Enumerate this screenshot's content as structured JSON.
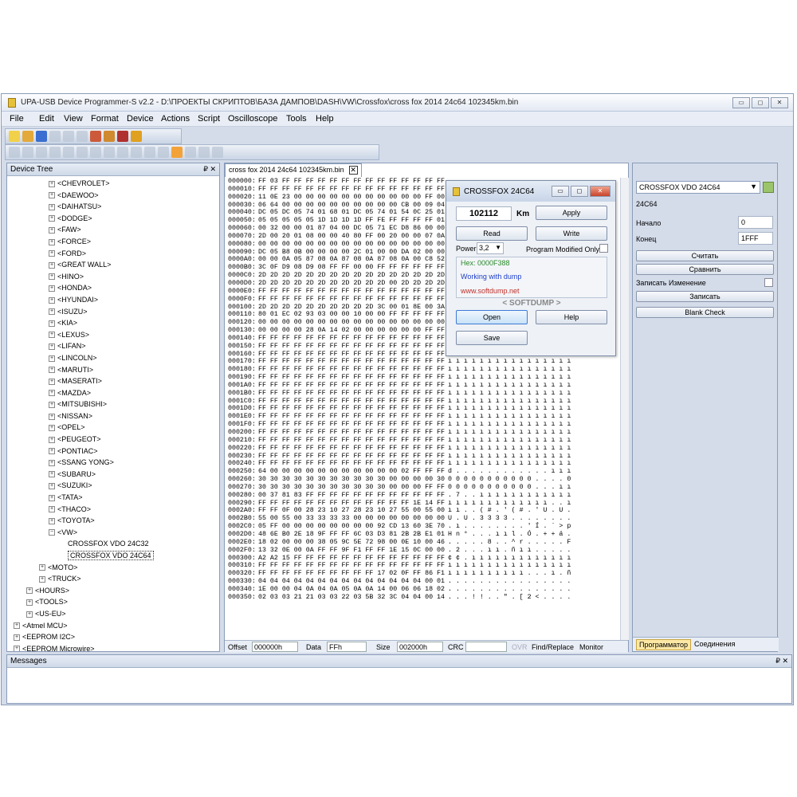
{
  "window": {
    "title": "UPA-USB Device Programmer-S v2.2 - D:\\ПРОЕКТЫ СКРИПТОВ\\БАЗА ДАМПОВ\\DASH\\VW\\Crossfox\\cross fox 2014 24c64 102345km.bin",
    "buttons": {
      "minimize": "▭",
      "maximize": "◻",
      "close": "✕"
    }
  },
  "menu": [
    "File",
    "Edit",
    "View",
    "Format",
    "Device",
    "Actions",
    "Script",
    "Oscilloscope",
    "Tools",
    "Help"
  ],
  "device_tree": {
    "title": "Device Tree",
    "pin": "₽ ✕",
    "items": [
      {
        "label": "<CHEVROLET>",
        "level": 2,
        "exp": "+"
      },
      {
        "label": "<DAEWOO>",
        "level": 2,
        "exp": "+"
      },
      {
        "label": "<DAIHATSU>",
        "level": 2,
        "exp": "+"
      },
      {
        "label": "<DODGE>",
        "level": 2,
        "exp": "+"
      },
      {
        "label": "<FAW>",
        "level": 2,
        "exp": "+"
      },
      {
        "label": "<FORCE>",
        "level": 2,
        "exp": "+"
      },
      {
        "label": "<FORD>",
        "level": 2,
        "exp": "+"
      },
      {
        "label": "<GREAT WALL>",
        "level": 2,
        "exp": "+"
      },
      {
        "label": "<HINO>",
        "level": 2,
        "exp": "+"
      },
      {
        "label": "<HONDA>",
        "level": 2,
        "exp": "+"
      },
      {
        "label": "<HYUNDAI>",
        "level": 2,
        "exp": "+"
      },
      {
        "label": "<ISUZU>",
        "level": 2,
        "exp": "+"
      },
      {
        "label": "<KIA>",
        "level": 2,
        "exp": "+"
      },
      {
        "label": "<LEXUS>",
        "level": 2,
        "exp": "+"
      },
      {
        "label": "<LIFAN>",
        "level": 2,
        "exp": "+"
      },
      {
        "label": "<LINCOLN>",
        "level": 2,
        "exp": "+"
      },
      {
        "label": "<MARUTI>",
        "level": 2,
        "exp": "+"
      },
      {
        "label": "<MASERATI>",
        "level": 2,
        "exp": "+"
      },
      {
        "label": "<MAZDA>",
        "level": 2,
        "exp": "+"
      },
      {
        "label": "<MITSUBISHI>",
        "level": 2,
        "exp": "+"
      },
      {
        "label": "<NISSAN>",
        "level": 2,
        "exp": "+"
      },
      {
        "label": "<OPEL>",
        "level": 2,
        "exp": "+"
      },
      {
        "label": "<PEUGEOT>",
        "level": 2,
        "exp": "+"
      },
      {
        "label": "<PONTIAC>",
        "level": 2,
        "exp": "+"
      },
      {
        "label": "<SSANG YONG>",
        "level": 2,
        "exp": "+"
      },
      {
        "label": "<SUBARU>",
        "level": 2,
        "exp": "+"
      },
      {
        "label": "<SUZUKI>",
        "level": 2,
        "exp": "+"
      },
      {
        "label": "<TATA>",
        "level": 2,
        "exp": "+"
      },
      {
        "label": "<THACO>",
        "level": 2,
        "exp": "+"
      },
      {
        "label": "<TOYOTA>",
        "level": 2,
        "exp": "+"
      },
      {
        "label": "<VW>",
        "level": 2,
        "exp": "−"
      },
      {
        "label": "CROSSFOX VDO 24C32",
        "level": 3,
        "exp": ""
      },
      {
        "label": "CROSSFOX VDO 24C64",
        "level": 3,
        "exp": "",
        "selected": true
      },
      {
        "label": "<MOTO>",
        "level": 1,
        "exp": "+"
      },
      {
        "label": "<TRUCK>",
        "level": 1,
        "exp": "+"
      },
      {
        "label": "<HOURS>",
        "level": 0,
        "exp": "+"
      },
      {
        "label": "<TOOLS>",
        "level": 0,
        "exp": "+"
      },
      {
        "label": "<US-EU>",
        "level": 0,
        "exp": "+"
      },
      {
        "label": "<Atmel MCU>",
        "level": -1,
        "exp": "+"
      },
      {
        "label": "<EEPROM I2C>",
        "level": -1,
        "exp": "+"
      },
      {
        "label": "<EEPROM Microwire>",
        "level": -1,
        "exp": "+"
      }
    ]
  },
  "editor": {
    "tab": "cross fox 2014 24c64 102345km.bin",
    "rows": [
      [
        "000000:",
        "FF 03 FF FF FF FF FF FF FF FF FF FF FF FF FF FF",
        ""
      ],
      [
        "000010:",
        "FF FF FF FF FF FF FF FF FF FF FF FF FF FF FF FF",
        ""
      ],
      [
        "000020:",
        "11 0E 23 00 00 00 00 00 00 00 00 00 00 00 FF 00",
        ""
      ],
      [
        "000030:",
        "06 64 00 00 00 00 00 00 00 00 00 00 CB 00 09 04",
        ""
      ],
      [
        "000040:",
        "DC 05 DC 05 74 01 68 01 DC 05 74 01 54 0C 25 01",
        ""
      ],
      [
        "000050:",
        "05 05 05 05 05 1D 1D 1D 1D FF FE FF FF FF FF 01",
        ""
      ],
      [
        "000060:",
        "00 32 00 00 01 87 04 00 DC 05 71 EC D8 86 00 00",
        ""
      ],
      [
        "000070:",
        "2D 00 20 01 08 00 00 40 80 FF 00 20 00 00 07 0A",
        ""
      ],
      [
        "000080:",
        "00 00 00 00 00 00 00 00 00 00 00 00 00 00 00 00",
        ""
      ],
      [
        "000090:",
        "DC 05 B8 0B 00 00 00 00 2C 01 00 00 DA 02 00 00",
        ""
      ],
      [
        "0000A0:",
        "00 00 0A 05 87 08 0A 87 08 0A 87 08 0A 00 C8 52",
        ""
      ],
      [
        "0000B0:",
        "3C 0F D9 08 D9 08 FF FF 00 00 FF FF FF FF FF FF",
        ""
      ],
      [
        "0000C0:",
        "2D 2D 2D 2D 2D 2D 2D 2D 2D 2D 2D 2D 2D 2D 2D 2D",
        ""
      ],
      [
        "0000D0:",
        "2D 2D 2D 2D 2D 2D 2D 2D 2D 2D 2D 00 2D 2D 2D 2D",
        ""
      ],
      [
        "0000E0:",
        "FF FF FF FF FF FF FF FF FF FF FF FF FF FF FF FF",
        ""
      ],
      [
        "0000F0:",
        "FF FF FF FF FF FF FF FF FF FF FF FF FF FF FF FF",
        ""
      ],
      [
        "000100:",
        "2D 2D 2D 2D 2D 2D 2D 2D 2D 2D 3C 00 01 8E 00 3A 01",
        ""
      ],
      [
        "000110:",
        "80 01 EC 02 93 03 00 00 10 00 00 FF FF FF FF FF",
        ""
      ],
      [
        "000120:",
        "00 00 00 00 00 00 00 00 00 00 00 00 00 00 00 00",
        ""
      ],
      [
        "000130:",
        "00 00 00 00 28 0A 14 02 00 00 00 00 00 00 FF FF",
        ""
      ],
      [
        "000140:",
        "FF FF FF FF FF FF FF FF FF FF FF FF FF FF FF FF",
        ""
      ],
      [
        "000150:",
        "FF FF FF FF FF FF FF FF FF FF FF FF FF FF FF FF",
        "ı ı ı ı ı ı ı ı ı ı ı ı ı ı ı ı"
      ],
      [
        "000160:",
        "FF FF FF FF FF FF FF FF FF FF FF FF FF FF FF FF",
        "ı ı ı ı ı ı ı ı ı ı ı ı ı ı ı ı"
      ],
      [
        "000170:",
        "FF FF FF FF FF FF FF FF FF FF FF FF FF FF FF FF",
        "ı ı ı ı ı ı ı ı ı ı ı ı ı ı ı ı"
      ],
      [
        "000180:",
        "FF FF FF FF FF FF FF FF FF FF FF FF FF FF FF FF",
        "ı ı ı ı ı ı ı ı ı ı ı ı ı ı ı ı"
      ],
      [
        "000190:",
        "FF FF FF FF FF FF FF FF FF FF FF FF FF FF FF FF",
        "ı ı ı ı ı ı ı ı ı ı ı ı ı ı ı ı"
      ],
      [
        "0001A0:",
        "FF FF FF FF FF FF FF FF FF FF FF FF FF FF FF FF",
        "ı ı ı ı ı ı ı ı ı ı ı ı ı ı ı ı"
      ],
      [
        "0001B0:",
        "FF FF FF FF FF FF FF FF FF FF FF FF FF FF FF FF",
        "ı ı ı ı ı ı ı ı ı ı ı ı ı ı ı ı"
      ],
      [
        "0001C0:",
        "FF FF FF FF FF FF FF FF FF FF FF FF FF FF FF FF",
        "ı ı ı ı ı ı ı ı ı ı ı ı ı ı ı ı"
      ],
      [
        "0001D0:",
        "FF FF FF FF FF FF FF FF FF FF FF FF FF FF FF FF",
        "ı ı ı ı ı ı ı ı ı ı ı ı ı ı ı ı"
      ],
      [
        "0001E0:",
        "FF FF FF FF FF FF FF FF FF FF FF FF FF FF FF FF",
        "ı ı ı ı ı ı ı ı ı ı ı ı ı ı ı ı"
      ],
      [
        "0001F0:",
        "FF FF FF FF FF FF FF FF FF FF FF FF FF FF FF FF",
        "ı ı ı ı ı ı ı ı ı ı ı ı ı ı ı ı"
      ],
      [
        "000200:",
        "FF FF FF FF FF FF FF FF FF FF FF FF FF FF FF FF",
        "ı ı ı ı ı ı ı ı ı ı ı ı ı ı ı ı"
      ],
      [
        "000210:",
        "FF FF FF FF FF FF FF FF FF FF FF FF FF FF FF FF",
        "ı ı ı ı ı ı ı ı ı ı ı ı ı ı ı ı"
      ],
      [
        "000220:",
        "FF FF FF FF FF FF FF FF FF FF FF FF FF FF FF FF",
        "ı ı ı ı ı ı ı ı ı ı ı ı ı ı ı ı"
      ],
      [
        "000230:",
        "FF FF FF FF FF FF FF FF FF FF FF FF FF FF FF FF",
        "ı ı ı ı ı ı ı ı ı ı ı ı ı ı ı ı"
      ],
      [
        "000240:",
        "FF FF FF FF FF FF FF FF FF FF FF FF FF FF FF FF",
        "ı ı ı ı ı ı ı ı ı ı ı ı ı ı ı ı"
      ],
      [
        "000250:",
        "64 00 00 00 00 00 00 00 00 00 00 00 02 FF FF FF",
        "d . . . . . . . . . . . . ı ı ı"
      ],
      [
        "000260:",
        "30 30 30 30 30 30 30 30 30 30 30 00 00 00 00 30",
        "0 0 0 0 0 0 0 0 0 0 0 . . . . 0"
      ],
      [
        "000270:",
        "30 30 30 30 30 30 30 30 30 30 30 00 00 00 FF FF",
        "0 0 0 0 0 0 0 0 0 0 0 . . . ı ı"
      ],
      [
        "000280:",
        "00 37 81 83 FF FF FF FF FF FF FF FF FF FF FF FF",
        ". 7 . . ı ı ı ı ı ı ı ı ı ı ı ı"
      ],
      [
        "000290:",
        "FF FF FF FF FF FF FF FF FF FF FF FF FF 1E 14 FF",
        "ı ı ı ı ı ı ı ı ı ı ı ı ı . . ı"
      ],
      [
        "0002A0:",
        "FF FF 0F 00 28 23 10 27 28 23 10 27 55 00 55 00",
        "ı ı . . ( # . ' ( # . ' U . U ."
      ],
      [
        "0002B0:",
        "55 00 55 00 33 33 33 33 00 00 00 00 00 00 00 00",
        "U . U . 3 3 3 3 . . . . . . . ."
      ],
      [
        "0002C0:",
        "05 FF 00 00 00 00 00 00 00 00 92 CD 13 60 3E 70",
        ". ı . . . . . . . . ' Í . ` > p"
      ],
      [
        "0002D0:",
        "48 6E B0 2E 18 9F FF FF 6C 03 D3 81 2B 2B E1 01",
        "H n ° . . . ı ı l . Ó . + + á ."
      ],
      [
        "0002E0:",
        "18 02 00 00 00 38 05 9C 5E 72 98 00 0E 10 00 46",
        ". . . . . 8 . . ^ r . . . . . F"
      ],
      [
        "0002F0:",
        "13 32 0E 00 0A FF FF 9F F1 FF FF 1E 15 0C 00 00",
        ". 2 . . . ı ı . ñ ı ı . . . . ."
      ],
      [
        "000300:",
        "A2 A2 15 FF FF FF FF FF FF FF FF FF FF FF FF FF",
        "¢ ¢ . ı ı ı ı ı ı ı ı ı ı ı ı ı"
      ],
      [
        "000310:",
        "FF FF FF FF FF FF FF FF FF FF FF FF FF FF FF FF",
        "ı ı ı ı ı ı ı ı ı ı ı ı ı ı ı ı"
      ],
      [
        "000320:",
        "FF FF FF FF FF FF FF FF FF FF 17 02 0F FF 86 F1",
        "ı ı ı ı ı ı ı ı ı ı . . . ı . ñ"
      ],
      [
        "000330:",
        "04 04 04 04 04 04 04 04 04 04 04 04 04 04 00 01",
        ". . . . . . . . . . . . . . . ."
      ],
      [
        "000340:",
        "1E 00 00 04 0A 04 0A 05 0A 0A 14 00 06 06 18 02",
        ". . . . . . . . . . . . . . . ."
      ],
      [
        "000350:",
        "02 03 03 21 21 03 03 22 03 5B 32 3C 04 04 00 14",
        ". . . ! ! . . \" . [ 2 < . . . ."
      ]
    ],
    "status": {
      "offset_label": "Offset",
      "offset_value": "000000h",
      "data_label": "Data",
      "data_value": "FFh",
      "size_label": "Size",
      "size_value": "002000h",
      "crc_label": "CRC",
      "crc_value": "",
      "ovr": "OVR",
      "find": "Find/Replace",
      "monitor": "Monitor"
    }
  },
  "popup": {
    "title": "CROSSFOX 24C64",
    "km_value": "102112",
    "km_label": "Km",
    "apply": "Apply",
    "read": "Read",
    "write": "Write",
    "power_label": "Power",
    "power_value": "3,2",
    "modified_label": "Program Modified Only",
    "hex_line": "Hex: 0000F388",
    "status_line": "Working with dump",
    "site": "www.softdump.net",
    "brand": "< SOFTDUMP >",
    "open": "Open",
    "help": "Help",
    "save": "Save",
    "colors": {
      "hex": "#2a8a2a",
      "status": "#1e3ec8",
      "site": "#c0302a"
    }
  },
  "right_panel": {
    "device": "CROSSFOX VDO 24C64",
    "chip": "24C64",
    "start_label": "Начало",
    "start_value": "0",
    "end_label": "Конец",
    "end_value": "1FFF",
    "read_btn": "Считать",
    "compare_btn": "Сравнить",
    "write_change_label": "Записать Изменение",
    "write_btn": "Записать",
    "blank_btn": "Blank Check",
    "tabs": [
      "Программатор",
      "Соединения"
    ]
  },
  "messages": {
    "title": "Messages",
    "pin": "₽ ✕"
  }
}
